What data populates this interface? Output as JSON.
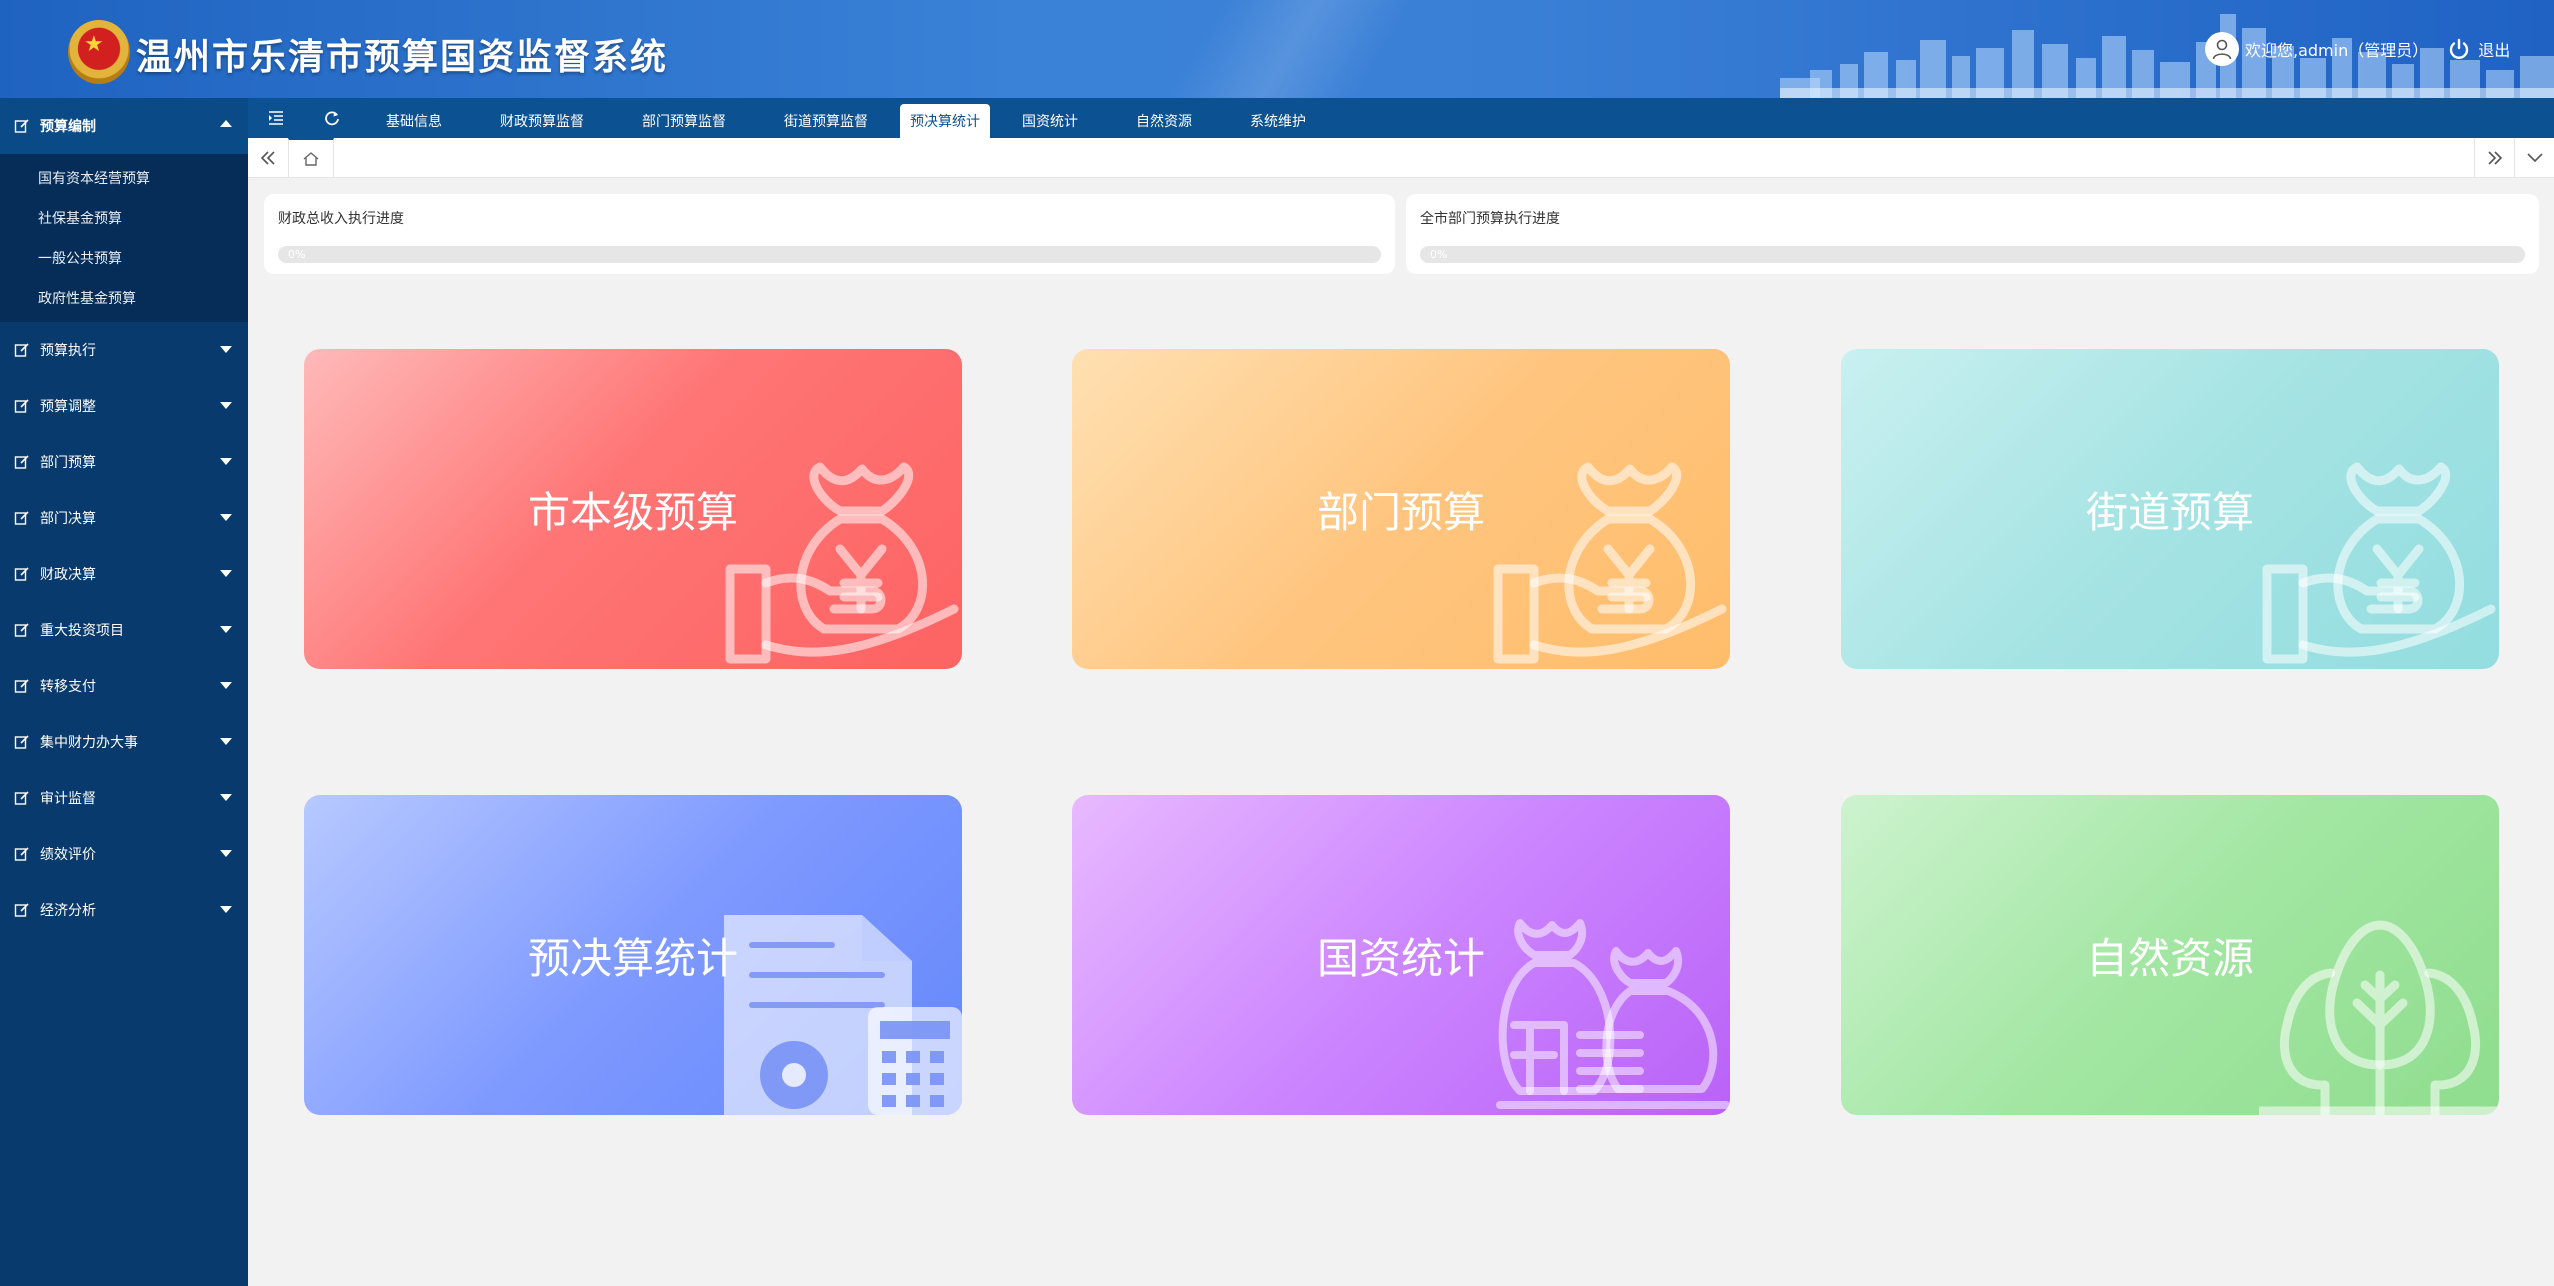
{
  "header": {
    "title": "温州市乐清市预算国资监督系统",
    "welcome": "欢迎您,admin（管理员）",
    "logout": "退出"
  },
  "sidebar": {
    "open_group": "预算编制",
    "sub_items": [
      "国有资本经营预算",
      "社保基金预算",
      "一般公共预算",
      "政府性基金预算"
    ],
    "groups": [
      "预算执行",
      "预算调整",
      "部门预算",
      "部门决算",
      "财政决算",
      "重大投资项目",
      "转移支付",
      "集中财力办大事",
      "审计监督",
      "绩效评价",
      "经济分析"
    ]
  },
  "topnav": {
    "tabs": [
      "基础信息",
      "财政预算监督",
      "部门预算监督",
      "街道预算监督",
      "预决算统计",
      "国资统计",
      "自然资源",
      "系统维护"
    ],
    "active": "预决算统计"
  },
  "progress": [
    {
      "title": "财政总收入执行进度",
      "value": 0,
      "text": "0%"
    },
    {
      "title": "全市部门预算执行进度",
      "value": 0,
      "text": "0%"
    }
  ],
  "cards": [
    "市本级预算",
    "部门预算",
    "街道预算",
    "预决算统计",
    "国资统计",
    "自然资源"
  ]
}
